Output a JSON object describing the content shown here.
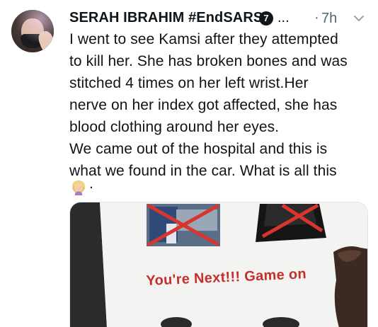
{
  "user": {
    "display_name": "SERAH IBRAHIM #EndSARS",
    "badge_count": "7",
    "ellipsis": "...",
    "separator": "·",
    "timestamp": "7h"
  },
  "tweet": {
    "lines": [
      "I went to see Kamsi after they attempted",
      "to kill her. She has broken bones and was",
      "stitched 4 times on her left wrist.Her",
      "nerve on her index got affected, she has",
      "blood clothing around her eyes.",
      "We came out of the hospital and this is",
      "what we found in the car. What is all this"
    ],
    "trailing_punctuation": "."
  },
  "media": {
    "poster_text": "You're Next!!! Game on"
  },
  "icons": {
    "emoji": "woman-facepalming-icon",
    "menu": "chevron-down-icon"
  },
  "colors": {
    "text": "#0f1419",
    "secondary": "#536471",
    "poster_red": "#c4302b",
    "cross_red": "#d8352f"
  }
}
